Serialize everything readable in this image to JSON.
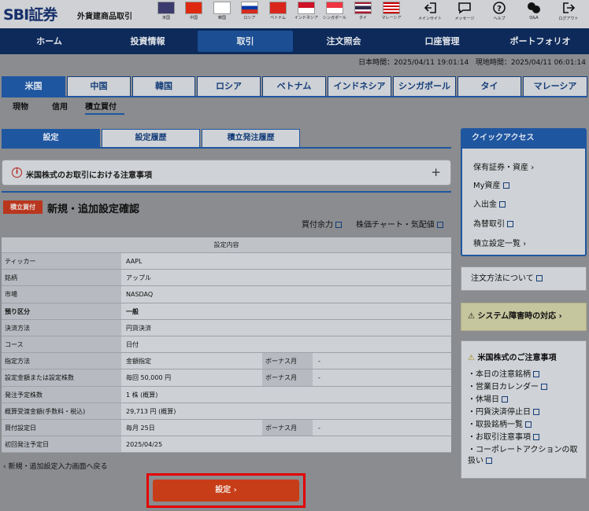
{
  "header": {
    "logo": "SBI証券",
    "logo_sub": "外貨建商品取引",
    "flags": [
      {
        "label": "米国",
        "color": "#3c3b6e"
      },
      {
        "label": "中国",
        "color": "#de2910"
      },
      {
        "label": "韓国",
        "color": "#ffffff"
      },
      {
        "label": "ロシア",
        "color": "#0039a6"
      },
      {
        "label": "ベトナム",
        "color": "#da251d"
      },
      {
        "label": "インドネシア",
        "color": "#ce1126"
      },
      {
        "label": "シンガポール",
        "color": "#ef3340"
      },
      {
        "label": "タイ",
        "color": "#2d2a4a"
      },
      {
        "label": "マレーシア",
        "color": "#cc0001"
      }
    ],
    "tools": [
      "メインサイト",
      "メッセージ",
      "ヘルプ",
      "Q&A",
      "ログアウト"
    ]
  },
  "nav": {
    "items": [
      "ホーム",
      "投資情報",
      "取引",
      "注文照会",
      "口座管理",
      "ポートフォリオ"
    ],
    "active_index": 2
  },
  "time": {
    "jp": "日本時間：2025/04/11 19:01:14",
    "local": "現地時間：2025/04/11 06:01:14"
  },
  "country_tabs": [
    "米国",
    "中国",
    "韓国",
    "ロシア",
    "ベトナム",
    "インドネシア",
    "シンガポール",
    "タイ",
    "マレーシア"
  ],
  "sub_tabs": [
    "現物",
    "信用",
    "積立買付"
  ],
  "setting_tabs": [
    "設定",
    "設定履歴",
    "積立発注履歴"
  ],
  "notice": {
    "text": "米国株式のお取引における注意事項",
    "icon": "i",
    "plus": "+"
  },
  "page": {
    "badge": "積立買付",
    "title": "新規・追加設定確認",
    "link_buying_power": "買付余力",
    "link_chart": "株価チャート・気配値"
  },
  "table": {
    "header": "設定内容",
    "rows": [
      {
        "k": "ティッカー",
        "v": "AAPL"
      },
      {
        "k": "銘柄",
        "v": "アップル"
      },
      {
        "k": "市場",
        "v": "NASDAQ"
      },
      {
        "k": "預り区分",
        "v": "一般"
      },
      {
        "k": "決済方法",
        "v": "円貨決済"
      },
      {
        "k": "コース",
        "v": "日付"
      },
      {
        "k": "指定方法",
        "v": "金額指定",
        "k2": "ボーナス月",
        "v2": "-"
      },
      {
        "k": "設定金額または設定株数",
        "v": "毎回 50,000 円",
        "k2": "ボーナス月",
        "v2": "-"
      },
      {
        "k": "発注予定株数",
        "v": "1 株 (概算)"
      },
      {
        "k": "概算受渡金額(手数料・税込)",
        "v": "29,713 円 (概算)"
      },
      {
        "k": "買付設定日",
        "v": "毎月 25日",
        "k2": "ボーナス月",
        "v2": "-"
      },
      {
        "k": "初回発注予定日",
        "v": "2025/04/25"
      }
    ]
  },
  "back_link": "新規・追加設定入力画面へ戻る",
  "submit_label": "設定",
  "chevron": "›",
  "quick_access": {
    "title": "クイックアクセス",
    "items": [
      "保有証券・資産",
      "My資産",
      "入出金",
      "為替取引",
      "積立設定一覧"
    ]
  },
  "order_method": "注文方法について",
  "system_failure": "システム障害時の対応",
  "notes": {
    "title": "米国株式のご注意事項",
    "items": [
      "本日の注意銘柄",
      "営業日カレンダー",
      "休場日",
      "円貨決済停止日",
      "取扱銘柄一覧",
      "お取引注意事項",
      "コーポレートアクションの取扱い"
    ]
  },
  "colors": {
    "nav": "#0d2a5a",
    "accent": "#1f56a0",
    "submit": "#c73d18",
    "highlight": "#e40000"
  }
}
